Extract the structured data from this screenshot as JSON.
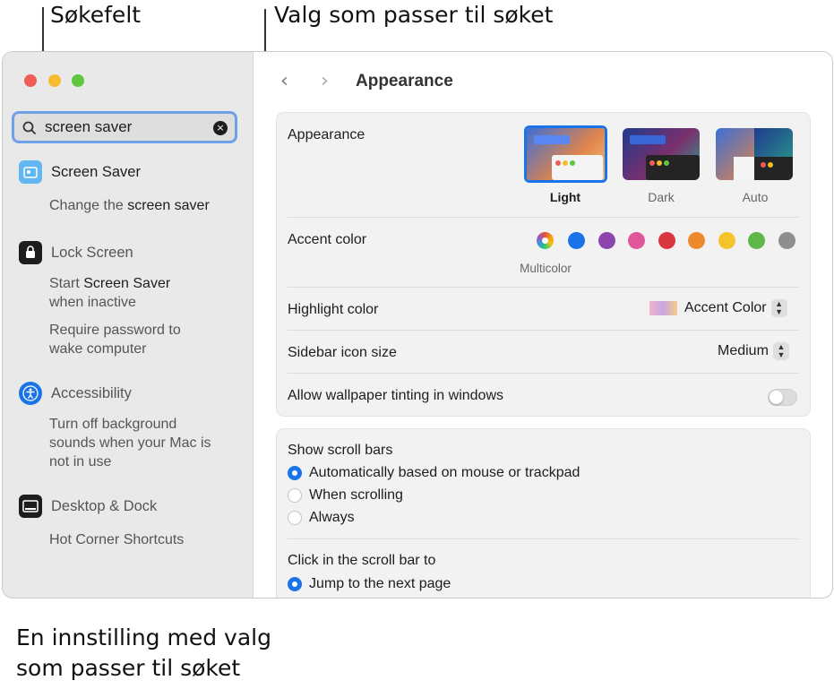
{
  "callouts": {
    "search_field": "Søkefelt",
    "matching_options": "Valg som passer til søket",
    "setting_line1": "En innstilling med valg",
    "setting_line2": "som passer til søket"
  },
  "search": {
    "value": "screen saver",
    "clear_icon": "×"
  },
  "sidebar": {
    "screen_saver": {
      "label": "Screen Saver",
      "sub1_a": "Change the ",
      "sub1_b": "screen saver"
    },
    "lock_screen": {
      "label": "Lock Screen",
      "sub1_a": "Start ",
      "sub1_b": "Screen Saver",
      "sub1_c": "when inactive",
      "sub2_a": "Require password to",
      "sub2_b": "wake computer"
    },
    "accessibility": {
      "label": "Accessibility",
      "sub_a": "Turn off background",
      "sub_b": "sounds when your Mac is",
      "sub_c": "not in use"
    },
    "desktop_dock": {
      "label": "Desktop & Dock",
      "sub": "Hot Corner Shortcuts"
    }
  },
  "header": {
    "back": "‹",
    "forward": "›",
    "title": "Appearance"
  },
  "appearance": {
    "label": "Appearance",
    "options": [
      "Light",
      "Dark",
      "Auto"
    ],
    "selected": "Light"
  },
  "accent": {
    "label": "Accent color",
    "selected_label": "Multicolor",
    "colors": [
      "#1a73e8",
      "#8e44ad",
      "#e0569b",
      "#d9363e",
      "#ee8a2e",
      "#f5c32c",
      "#5fb74a",
      "#8e8e8e"
    ]
  },
  "highlight": {
    "label": "Highlight color",
    "value": "Accent Color"
  },
  "sidebar_icon_size": {
    "label": "Sidebar icon size",
    "value": "Medium"
  },
  "wallpaper_tinting": {
    "label": "Allow wallpaper tinting in windows",
    "enabled": false
  },
  "scroll_bars": {
    "label": "Show scroll bars",
    "options": [
      "Automatically based on mouse or trackpad",
      "When scrolling",
      "Always"
    ],
    "selected": "Automatically based on mouse or trackpad"
  },
  "click_scroll": {
    "label": "Click in the scroll bar to",
    "option": "Jump to the next page"
  }
}
